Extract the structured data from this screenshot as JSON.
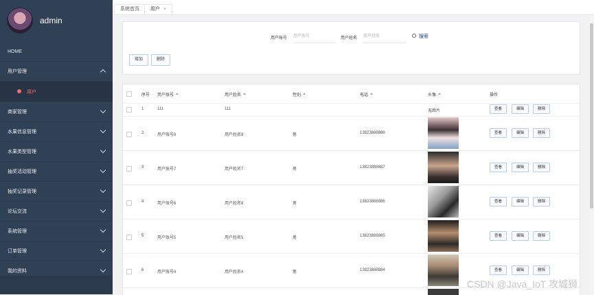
{
  "sidebar": {
    "username": "admin",
    "items": [
      {
        "label": "HOME"
      },
      {
        "label": "用户管理"
      },
      {
        "label": "用户"
      },
      {
        "label": "商家管理"
      },
      {
        "label": "水果信息管理"
      },
      {
        "label": "水果类型管理"
      },
      {
        "label": "抽奖活动管理"
      },
      {
        "label": "抽奖记录管理"
      },
      {
        "label": "论坛交流"
      },
      {
        "label": "系统管理"
      },
      {
        "label": "订单管理"
      },
      {
        "label": "我的资料"
      }
    ]
  },
  "tabs": [
    {
      "label": "系统首页"
    },
    {
      "label": "用户",
      "close": "×"
    }
  ],
  "search": {
    "account_label": "用户账号",
    "account_placeholder": "用户账号",
    "name_label": "用户姓名",
    "name_placeholder": "用户姓名",
    "search_button": "搜索",
    "add_button": "增加",
    "delete_button": "删除"
  },
  "table": {
    "headers": [
      "序号",
      "用户账号",
      "用户姓名",
      "性别",
      "电话",
      "头像",
      "操作"
    ],
    "actions": [
      "查看",
      "编辑",
      "删除"
    ],
    "rows": [
      {
        "no": "1",
        "account": "111",
        "name": "111",
        "gender": "",
        "phone": "",
        "avatar_text": "无图片"
      },
      {
        "no": "2",
        "account": "用户账号8",
        "name": "用户姓名8",
        "gender": "男",
        "phone": "13823888888",
        "avatar_text": ""
      },
      {
        "no": "3",
        "account": "用户账号7",
        "name": "用户姓名7",
        "gender": "男",
        "phone": "13823888887",
        "avatar_text": ""
      },
      {
        "no": "4",
        "account": "用户账号6",
        "name": "用户姓名6",
        "gender": "男",
        "phone": "13823888886",
        "avatar_text": ""
      },
      {
        "no": "5",
        "account": "用户账号5",
        "name": "用户姓名5",
        "gender": "男",
        "phone": "13823888885",
        "avatar_text": ""
      },
      {
        "no": "6",
        "account": "用户账号4",
        "name": "用户姓名4",
        "gender": "男",
        "phone": "13823888884",
        "avatar_text": ""
      }
    ]
  },
  "watermark": "CSDN @Java_IoT 攻城狮",
  "colors": {
    "sidebar_bg": "#304156",
    "active_menu": "#f56c6c",
    "button_border": "#b8cce6"
  }
}
